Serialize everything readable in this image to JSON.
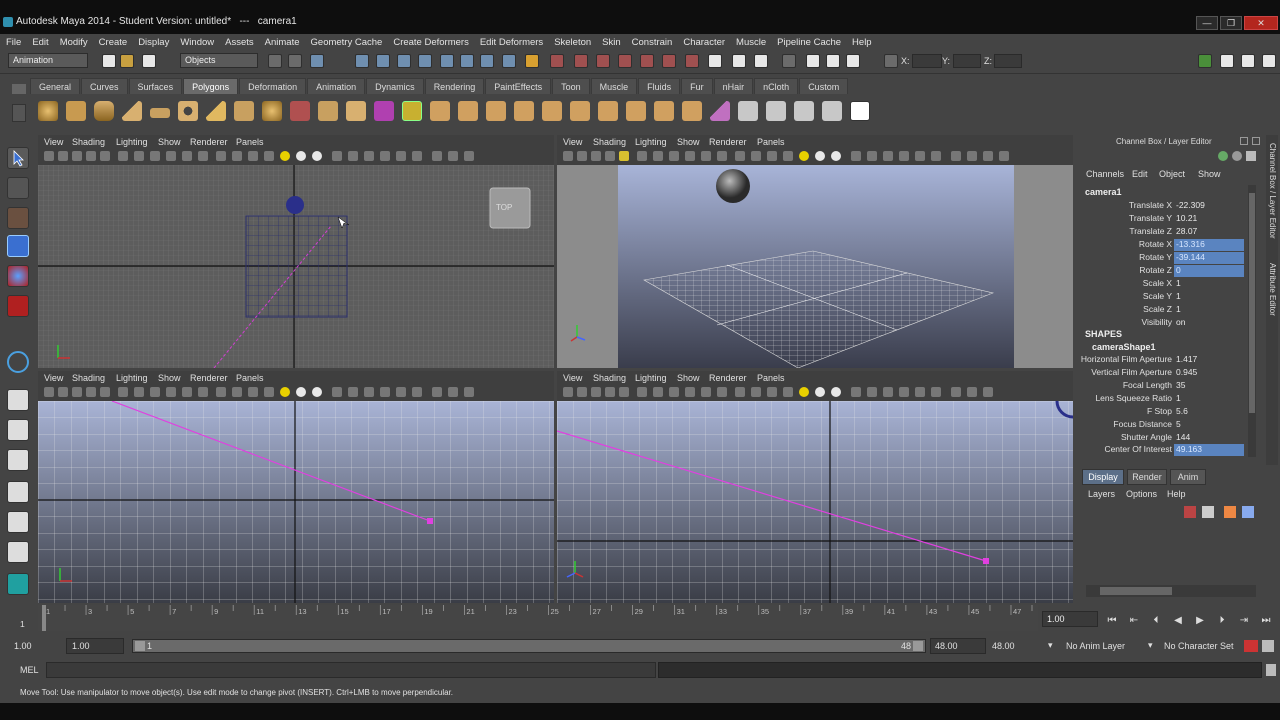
{
  "window": {
    "title": "Autodesk Maya 2014 - Student Version: untitled*   ---   camera1",
    "min_label": "—",
    "max_label": "❐",
    "close_label": "✕"
  },
  "menubar": [
    "File",
    "Edit",
    "Modify",
    "Create",
    "Display",
    "Window",
    "Assets",
    "Animate",
    "Geometry Cache",
    "Create Deformers",
    "Edit Deformers",
    "Skeleton",
    "Skin",
    "Constrain",
    "Character",
    "Muscle",
    "Pipeline Cache",
    "Help"
  ],
  "status_line": {
    "mode": "Animation",
    "selection_mode": "Objects",
    "x_label": "X:",
    "y_label": "Y:",
    "z_label": "Z:"
  },
  "shelf_tabs": [
    "General",
    "Curves",
    "Surfaces",
    "Polygons",
    "Deformation",
    "Animation",
    "Dynamics",
    "Rendering",
    "PaintEffects",
    "Toon",
    "Muscle",
    "Fluids",
    "Fur",
    "nHair",
    "nCloth",
    "Custom"
  ],
  "shelf_active_tab": "Polygons",
  "panel_menu": [
    "View",
    "Shading",
    "Lighting",
    "Show",
    "Renderer",
    "Panels"
  ],
  "viewports": {
    "top_label": "TOP"
  },
  "channel_box": {
    "header": "Channel Box / Layer Editor",
    "menu": [
      "Channels",
      "Edit",
      "Object",
      "Show"
    ],
    "object": "camera1",
    "attributes": [
      {
        "label": "Translate X",
        "value": "-22.309",
        "selected": false
      },
      {
        "label": "Translate Y",
        "value": "10.21",
        "selected": false
      },
      {
        "label": "Translate Z",
        "value": "28.07",
        "selected": false
      },
      {
        "label": "Rotate X",
        "value": "-13.316",
        "selected": true
      },
      {
        "label": "Rotate Y",
        "value": "-39.144",
        "selected": true
      },
      {
        "label": "Rotate Z",
        "value": "0",
        "selected": true
      },
      {
        "label": "Scale X",
        "value": "1",
        "selected": false
      },
      {
        "label": "Scale Y",
        "value": "1",
        "selected": false
      },
      {
        "label": "Scale Z",
        "value": "1",
        "selected": false
      },
      {
        "label": "Visibility",
        "value": "on",
        "selected": false
      }
    ],
    "shapes_header": "SHAPES",
    "shape_name": "cameraShape1",
    "shape_attributes": [
      {
        "label": "Horizontal Film Aperture",
        "value": "1.417",
        "selected": false
      },
      {
        "label": "Vertical Film Aperture",
        "value": "0.945",
        "selected": false
      },
      {
        "label": "Focal Length",
        "value": "35",
        "selected": false
      },
      {
        "label": "Lens Squeeze Ratio",
        "value": "1",
        "selected": false
      },
      {
        "label": "F Stop",
        "value": "5.6",
        "selected": false
      },
      {
        "label": "Focus Distance",
        "value": "5",
        "selected": false
      },
      {
        "label": "Shutter Angle",
        "value": "144",
        "selected": false
      },
      {
        "label": "Center Of Interest",
        "value": "49.163",
        "selected": true
      }
    ],
    "side_tabs": [
      "Channel Box / Layer Editor",
      "Attribute Editor"
    ]
  },
  "layer_editor": {
    "tabs": [
      "Display",
      "Render",
      "Anim"
    ],
    "active_tab": "Display",
    "menu": [
      "Layers",
      "Options",
      "Help"
    ]
  },
  "time_slider": {
    "ticks": [
      "1",
      "2",
      "3",
      "4",
      "5",
      "6",
      "7",
      "8",
      "9",
      "10",
      "11",
      "12",
      "13",
      "14",
      "15",
      "16",
      "17",
      "18",
      "19",
      "20",
      "21",
      "22",
      "23",
      "24",
      "25",
      "26",
      "27",
      "28",
      "29",
      "30",
      "31",
      "32",
      "33",
      "34",
      "35",
      "36",
      "37",
      "38",
      "39",
      "40",
      "41",
      "42",
      "43",
      "44",
      "45",
      "46",
      "47",
      "48"
    ],
    "current_frame_left": "1",
    "current_time": "1.00"
  },
  "range_slider": {
    "start": "1.00",
    "playback_start": "1.00",
    "range_start_label": "1",
    "range_end_label": "48",
    "playback_end": "48.00",
    "end": "48.00",
    "anim_layer": "No Anim Layer",
    "character_set": "No Character Set"
  },
  "command_line": {
    "label": "MEL"
  },
  "help_line": {
    "text": "Move Tool: Use manipulator to move object(s). Use edit mode to change pivot (INSERT).  Ctrl+LMB to move perpendicular."
  }
}
